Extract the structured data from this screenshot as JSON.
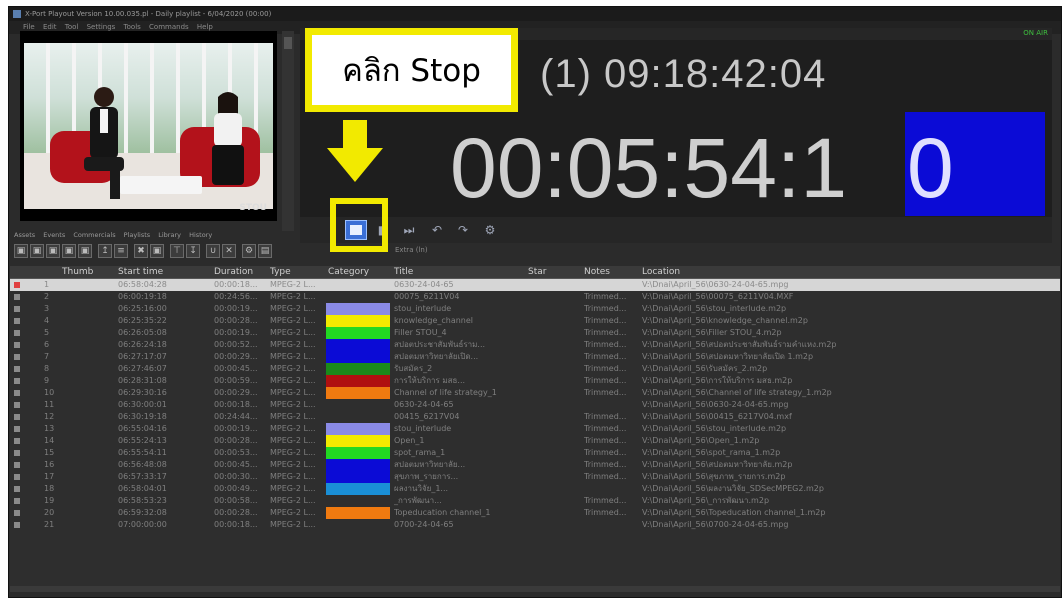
{
  "window": {
    "title": "X-Port Playout Version 10.00.035.pl - Daily playlist - 6/04/2020 (00:00)",
    "menu": [
      "File",
      "Edit",
      "Tool",
      "Settings",
      "Tools",
      "Commands",
      "Help"
    ]
  },
  "status": {
    "on_air": "ON AIR"
  },
  "callout": {
    "text": "คลิก Stop"
  },
  "timecode": {
    "current": "(1) 09:18:42:04",
    "remaining_main": "00:05:54:1",
    "remaining_last": "0"
  },
  "colors": {
    "highlight": "#f2ea00",
    "timecode_block": "#0b0bd6"
  },
  "panel_tabs": [
    "Assets",
    "Events",
    "Commercials",
    "Playlists",
    "Library",
    "History"
  ],
  "extra_label": "Extra (ln)",
  "table": {
    "headers": {
      "thumb": "Thumb",
      "start": "Start time",
      "duration": "Duration",
      "type": "Type",
      "category": "Category",
      "title": "Title",
      "star": "Star",
      "notes": "Notes",
      "location": "Location"
    },
    "rows": [
      {
        "num": "1",
        "start": "06:58:04:28",
        "dur": "00:00:18...",
        "type": "MPEG-2 L...",
        "cat": "",
        "title": "0630-24-04-65",
        "notes": "",
        "loc": "V:\\Dnai\\April_56\\0630-24-04-65.mpg"
      },
      {
        "num": "2",
        "start": "06:00:19:18",
        "dur": "00:24:56...",
        "type": "MPEG-2 L...",
        "cat": "",
        "title": "00075_6211V04",
        "notes": "Trimmed...",
        "loc": "V:\\Dnai\\April_56\\00075_6211V04.MXF"
      },
      {
        "num": "3",
        "start": "06:25:16:00",
        "dur": "00:00:19...",
        "type": "MPEG-2 L...",
        "cat": "#8a8ae6",
        "title": "stou_interlude",
        "notes": "Trimmed...",
        "loc": "V:\\Dnai\\April_56\\stou_interlude.m2p"
      },
      {
        "num": "4",
        "start": "06:25:35:22",
        "dur": "00:00:28...",
        "type": "MPEG-2 L...",
        "cat": "#f2ea00",
        "title": "knowledge_channel",
        "notes": "Trimmed...",
        "loc": "V:\\Dnai\\April_56\\knowledge_channel.m2p"
      },
      {
        "num": "5",
        "start": "06:26:05:08",
        "dur": "00:00:19...",
        "type": "MPEG-2 L...",
        "cat": "#22d822",
        "title": "Filler STOU_4",
        "notes": "Trimmed...",
        "loc": "V:\\Dnai\\April_56\\Filler STOU_4.m2p"
      },
      {
        "num": "6",
        "start": "06:26:24:18",
        "dur": "00:00:52...",
        "type": "MPEG-2 L...",
        "cat": "#0b0bd6",
        "title": "สปอตประชาสัมพันธ์ราม...",
        "notes": "Trimmed...",
        "loc": "V:\\Dnai\\April_56\\สปอตประชาสัมพันธ์รามคำแหง.m2p"
      },
      {
        "num": "7",
        "start": "06:27:17:07",
        "dur": "00:00:29...",
        "type": "MPEG-2 L...",
        "cat": "#0b0bd6",
        "title": "สปอตมหาวิทยาลัยเปิด...",
        "notes": "Trimmed...",
        "loc": "V:\\Dnai\\April_56\\สปอตมหาวิทยาลัยเปิด 1.m2p"
      },
      {
        "num": "8",
        "start": "06:27:46:07",
        "dur": "00:00:45...",
        "type": "MPEG-2 L...",
        "cat": "#1a8a1a",
        "title": "รับสมัคร_2",
        "notes": "Trimmed...",
        "loc": "V:\\Dnai\\April_56\\รับสมัคร_2.m2p"
      },
      {
        "num": "9",
        "start": "06:28:31:08",
        "dur": "00:00:59...",
        "type": "MPEG-2 L...",
        "cat": "#b01010",
        "title": "การให้บริการ มสธ...",
        "notes": "Trimmed...",
        "loc": "V:\\Dnai\\April_56\\การให้บริการ มสธ.m2p"
      },
      {
        "num": "10",
        "start": "06:29:30:16",
        "dur": "00:00:29...",
        "type": "MPEG-2 L...",
        "cat": "#f07a10",
        "title": "Channel of life strategy_1",
        "notes": "Trimmed...",
        "loc": "V:\\Dnai\\April_56\\Channel of life strategy_1.m2p"
      },
      {
        "num": "11",
        "start": "06:30:00:01",
        "dur": "00:00:18...",
        "type": "MPEG-2 L...",
        "cat": "",
        "title": "0630-24-04-65",
        "notes": "",
        "loc": "V:\\Dnai\\April_56\\0630-24-04-65.mpg"
      },
      {
        "num": "12",
        "start": "06:30:19:18",
        "dur": "00:24:44...",
        "type": "MPEG-2 L...",
        "cat": "",
        "title": "00415_6217V04",
        "notes": "Trimmed...",
        "loc": "V:\\Dnai\\April_56\\00415_6217V04.mxf"
      },
      {
        "num": "13",
        "start": "06:55:04:16",
        "dur": "00:00:19...",
        "type": "MPEG-2 L...",
        "cat": "#8a8ae6",
        "title": "stou_interlude",
        "notes": "Trimmed...",
        "loc": "V:\\Dnai\\April_56\\stou_interlude.m2p"
      },
      {
        "num": "14",
        "start": "06:55:24:13",
        "dur": "00:00:28...",
        "type": "MPEG-2 L...",
        "cat": "#f2ea00",
        "title": "Open_1",
        "notes": "Trimmed...",
        "loc": "V:\\Dnai\\April_56\\Open_1.m2p"
      },
      {
        "num": "15",
        "start": "06:55:54:11",
        "dur": "00:00:53...",
        "type": "MPEG-2 L...",
        "cat": "#22d822",
        "title": "spot_rama_1",
        "notes": "Trimmed...",
        "loc": "V:\\Dnai\\April_56\\spot_rama_1.m2p"
      },
      {
        "num": "16",
        "start": "06:56:48:08",
        "dur": "00:00:45...",
        "type": "MPEG-2 L...",
        "cat": "#0b0bd6",
        "title": "สปอตมหาวิทยาลัย...",
        "notes": "Trimmed...",
        "loc": "V:\\Dnai\\April_56\\สปอตมหาวิทยาลัย.m2p"
      },
      {
        "num": "17",
        "start": "06:57:33:17",
        "dur": "00:00:30...",
        "type": "MPEG-2 L...",
        "cat": "#0b0bd6",
        "title": "สุขภาพ_รายการ...",
        "notes": "Trimmed...",
        "loc": "V:\\Dnai\\April_56\\สุขภาพ_รายการ.m2p"
      },
      {
        "num": "18",
        "start": "06:58:04:01",
        "dur": "00:00:49...",
        "type": "MPEG-2 L...",
        "cat": "#1a8fd6",
        "title": "ผลงานวิจัย_1...",
        "notes": "",
        "loc": "V:\\Dnai\\April_56\\ผลงานวิจัย_SDSecMPEG2.m2p"
      },
      {
        "num": "19",
        "start": "06:58:53:23",
        "dur": "00:00:58...",
        "type": "MPEG-2 L...",
        "cat": "",
        "title": "_การพัฒนา...",
        "notes": "Trimmed...",
        "loc": "V:\\Dnai\\April_56\\_การพัฒนา.m2p"
      },
      {
        "num": "20",
        "start": "06:59:32:08",
        "dur": "00:00:28...",
        "type": "MPEG-2 L...",
        "cat": "#f07a10",
        "title": "Topeducation channel_1",
        "notes": "Trimmed...",
        "loc": "V:\\Dnai\\April_56\\Topeducation channel_1.m2p"
      },
      {
        "num": "21",
        "start": "07:00:00:00",
        "dur": "00:00:18...",
        "type": "MPEG-2 L...",
        "cat": "",
        "title": "0700-24-04-65",
        "notes": "",
        "loc": "V:\\Dnai\\April_56\\0700-24-04-65.mpg"
      }
    ]
  }
}
